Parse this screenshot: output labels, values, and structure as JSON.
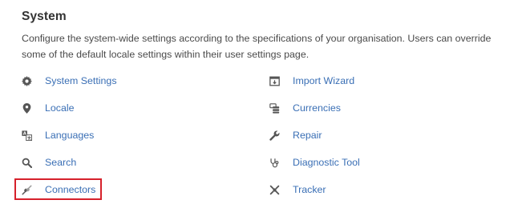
{
  "section": {
    "title": "System",
    "description": "Configure the system-wide settings according to the specifications of your organisation. Users can override some of the default locale settings within their user settings page."
  },
  "links_left": [
    {
      "label": "System Settings",
      "icon": "gear-icon"
    },
    {
      "label": "Locale",
      "icon": "map-pin-icon"
    },
    {
      "label": "Languages",
      "icon": "translate-icon"
    },
    {
      "label": "Search",
      "icon": "search-icon"
    },
    {
      "label": "Connectors",
      "icon": "connectors-icon"
    }
  ],
  "links_right": [
    {
      "label": "Import Wizard",
      "icon": "import-icon"
    },
    {
      "label": "Currencies",
      "icon": "currencies-icon"
    },
    {
      "label": "Repair",
      "icon": "wrench-icon"
    },
    {
      "label": "Diagnostic Tool",
      "icon": "stethoscope-icon"
    },
    {
      "label": "Tracker",
      "icon": "tracker-icon"
    }
  ],
  "colors": {
    "link": "#3a6fb5",
    "highlight": "#d6212b",
    "icon": "#555555"
  }
}
